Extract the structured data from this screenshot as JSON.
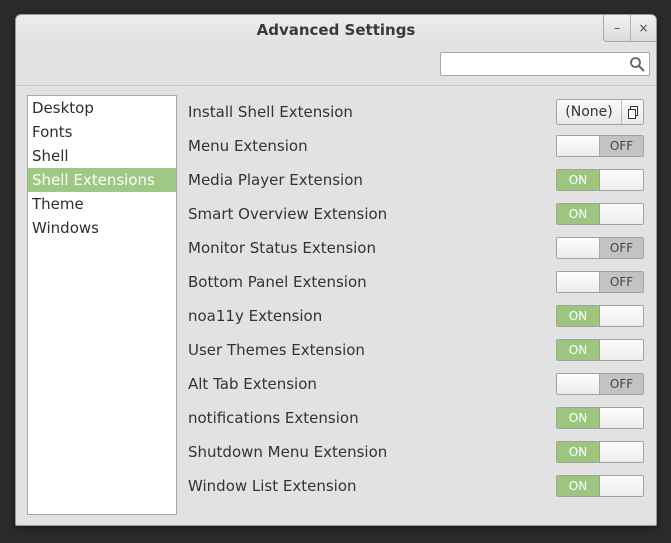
{
  "window": {
    "title": "Advanced Settings",
    "minimize_glyph": "–",
    "close_glyph": "×"
  },
  "search": {
    "value": "",
    "placeholder": "",
    "icon": "search-icon"
  },
  "sidebar": {
    "items": [
      {
        "label": "Desktop"
      },
      {
        "label": "Fonts"
      },
      {
        "label": "Shell"
      },
      {
        "label": "Shell Extensions",
        "selected": true
      },
      {
        "label": "Theme"
      },
      {
        "label": "Windows"
      }
    ]
  },
  "install": {
    "label": "Install Shell Extension",
    "file_button_label": "(None)",
    "icon": "file-chooser-icon"
  },
  "extensions": [
    {
      "label": "Menu Extension",
      "state": "OFF"
    },
    {
      "label": "Media Player Extension",
      "state": "ON"
    },
    {
      "label": "Smart Overview Extension",
      "state": "ON"
    },
    {
      "label": "Monitor Status Extension",
      "state": "OFF"
    },
    {
      "label": "Bottom Panel Extension",
      "state": "OFF"
    },
    {
      "label": "noa11y Extension",
      "state": "ON"
    },
    {
      "label": "User Themes Extension",
      "state": "ON"
    },
    {
      "label": "Alt Tab Extension",
      "state": "OFF"
    },
    {
      "label": "notifications Extension",
      "state": "ON"
    },
    {
      "label": "Shutdown Menu Extension",
      "state": "ON"
    },
    {
      "label": "Window List Extension",
      "state": "ON"
    }
  ],
  "colors": {
    "accent_green": "#9cc67f",
    "selection_green": "#9fc884",
    "off_gray": "#c3c3c3"
  }
}
